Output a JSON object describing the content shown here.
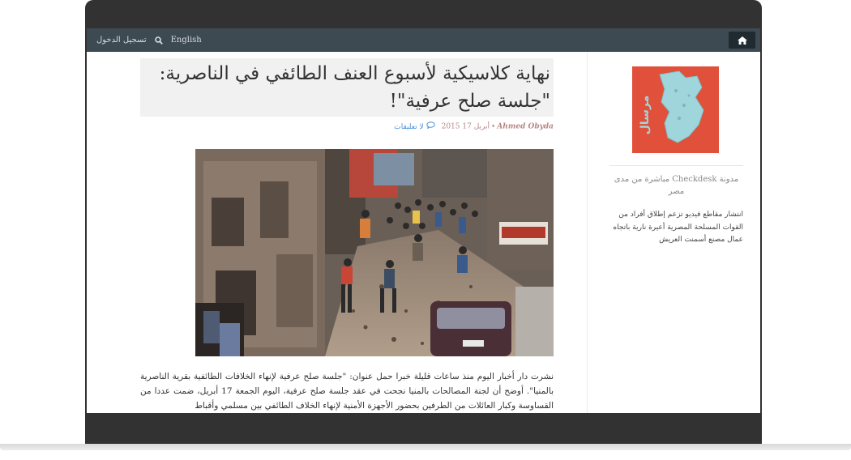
{
  "nav": {
    "login_label": "تسجيل الدخول",
    "search_icon": "search-icon",
    "language_label": "English",
    "home_icon": "home-icon"
  },
  "post": {
    "title": "نهاية كلاسيكية لأسبوع العنف الطائفي في الناصرية: \"جلسة صلح عرفية\"!",
    "author": "Ahmed Obyda",
    "date": "أبريل 17 2015",
    "comments_label": "لا تعليقات",
    "comments_icon": "comment-icon",
    "body": "نشرت دار أخبار اليوم منذ ساعات قليلة خبرا حمل عنوان: \"جلسة صلح عرفية لإنهاء الخلافات الطائفية بقرية الناصرية بالمنيا\". أوضح أن لجنة المصالحات بالمنيا نجحت في عقد جلسة صلح عرفية، اليوم الجمعة 17 أبريل، ضمت عددا من القساوسة وكبار العائلات من الطرفين بحضور الأجهزة الأمنية لإنهاء الخلاف الطائفي بين مسلمي وأقباط"
  },
  "sidebar": {
    "logo_text": "مرسال",
    "heading": "مدونة Checkdesk مباشرة من مدى مصر",
    "item_text": "انتشار مقاطع فيديو تزعم إطلاق أفراد من القوات المسلحة المصرية أعيرة نارية باتجاه عمال مصنع أسمنت العريش"
  },
  "colors": {
    "nav_bg": "#3d4a52",
    "frame": "#323232",
    "title_bg": "#f1f1f1",
    "author": "#b98686",
    "link": "#4a8fd8",
    "logo_bg": "#e0503a",
    "logo_map": "#9ed6dc"
  }
}
